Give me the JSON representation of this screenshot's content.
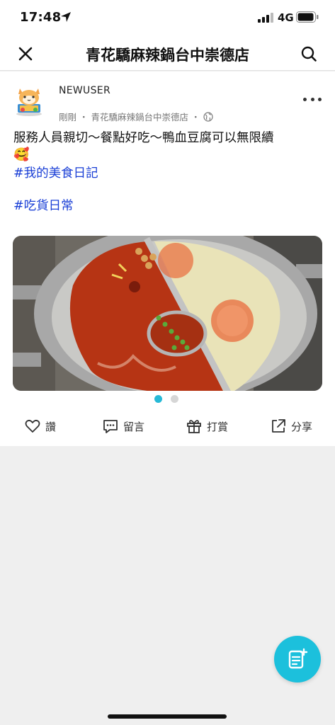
{
  "status_bar": {
    "time": "17:48",
    "network": "4G"
  },
  "nav": {
    "title": "青花驕麻辣鍋台中崇德店"
  },
  "post": {
    "username": "NEWUSER",
    "meta_time": "剛剛",
    "meta_sep1": "・",
    "meta_location": "青花驕麻辣鍋台中崇德店",
    "meta_sep2": "・",
    "text": "服務人員親切～餐點好吃～鴨血豆腐可以無限續",
    "emoji": "🥰",
    "hashtags": [
      "#我的美食日記",
      "#吃貨日常"
    ]
  },
  "pager": {
    "total": 2,
    "current": 1,
    "active_color": "#27b9d6",
    "inactive_color": "#d6d6d6"
  },
  "actions": {
    "like": "讚",
    "comment": "留言",
    "gift": "打賞",
    "share": "分享"
  },
  "colors": {
    "hashtag": "#1a3fd6",
    "fab": "#1cc0dc"
  }
}
